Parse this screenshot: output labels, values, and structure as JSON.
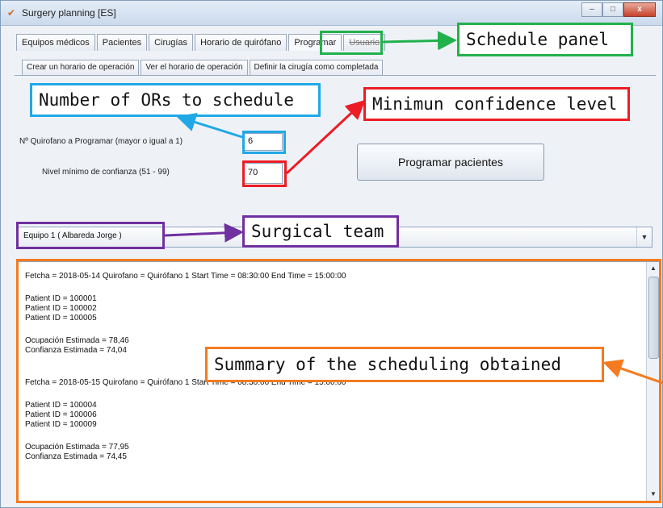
{
  "window": {
    "title": "Surgery planning [ES]",
    "controls": [
      "–",
      "□",
      "x"
    ]
  },
  "main_tabs": [
    {
      "label": "Equipos médicos"
    },
    {
      "label": "Pacientes"
    },
    {
      "label": "Cirugías"
    },
    {
      "label": "Horario de quirófano"
    },
    {
      "label": "Programar"
    },
    {
      "label": "Usuario"
    }
  ],
  "sub_tabs": [
    {
      "label": "Crear un horario de operación"
    },
    {
      "label": "Ver el horario de operación"
    },
    {
      "label": "Definir la cirugía como completada"
    }
  ],
  "form": {
    "num_or_label": "Nº Quirofano a Programar (mayor o igual a 1)",
    "num_or_value": "6",
    "confidence_label": "Nivel mínimo de confianza (51 - 99)",
    "confidence_value": "70",
    "schedule_button": "Programar pacientes",
    "team_selected": "Equipo 1 ( Albareda Jorge )"
  },
  "summary_lines": [
    "Fetcha = 2018-05-14   Quirofano =  Quirófano 1    Start Time =  08:30:00    End Time =  15:00:00",
    "Patient ID = 100001",
    "Patient ID = 100002",
    "Patient ID = 100005",
    "Ocupación Estimada = 78,46",
    "Confianza Estimada = 74,04",
    "Fetcha = 2018-05-15   Quirofano =  Quirófano 1    Start Time =  08:30:00    End Time =  15:00:00",
    "Patient ID = 100004",
    "Patient ID = 100006",
    "Patient ID = 100009",
    "Ocupación Estimada = 77,95",
    "Confianza Estimada = 74,45"
  ],
  "annotations": {
    "schedule_panel": "Schedule panel",
    "num_ors": "Number of ORs to schedule",
    "min_conf": "Minimun confidence level",
    "surgical_team": "Surgical team",
    "summary": "Summary of the scheduling obtained"
  },
  "colors": {
    "green": "#22b14c",
    "cyan": "#21a8e6",
    "red": "#ed1c24",
    "purple": "#7030a0",
    "orange": "#f47b20"
  }
}
